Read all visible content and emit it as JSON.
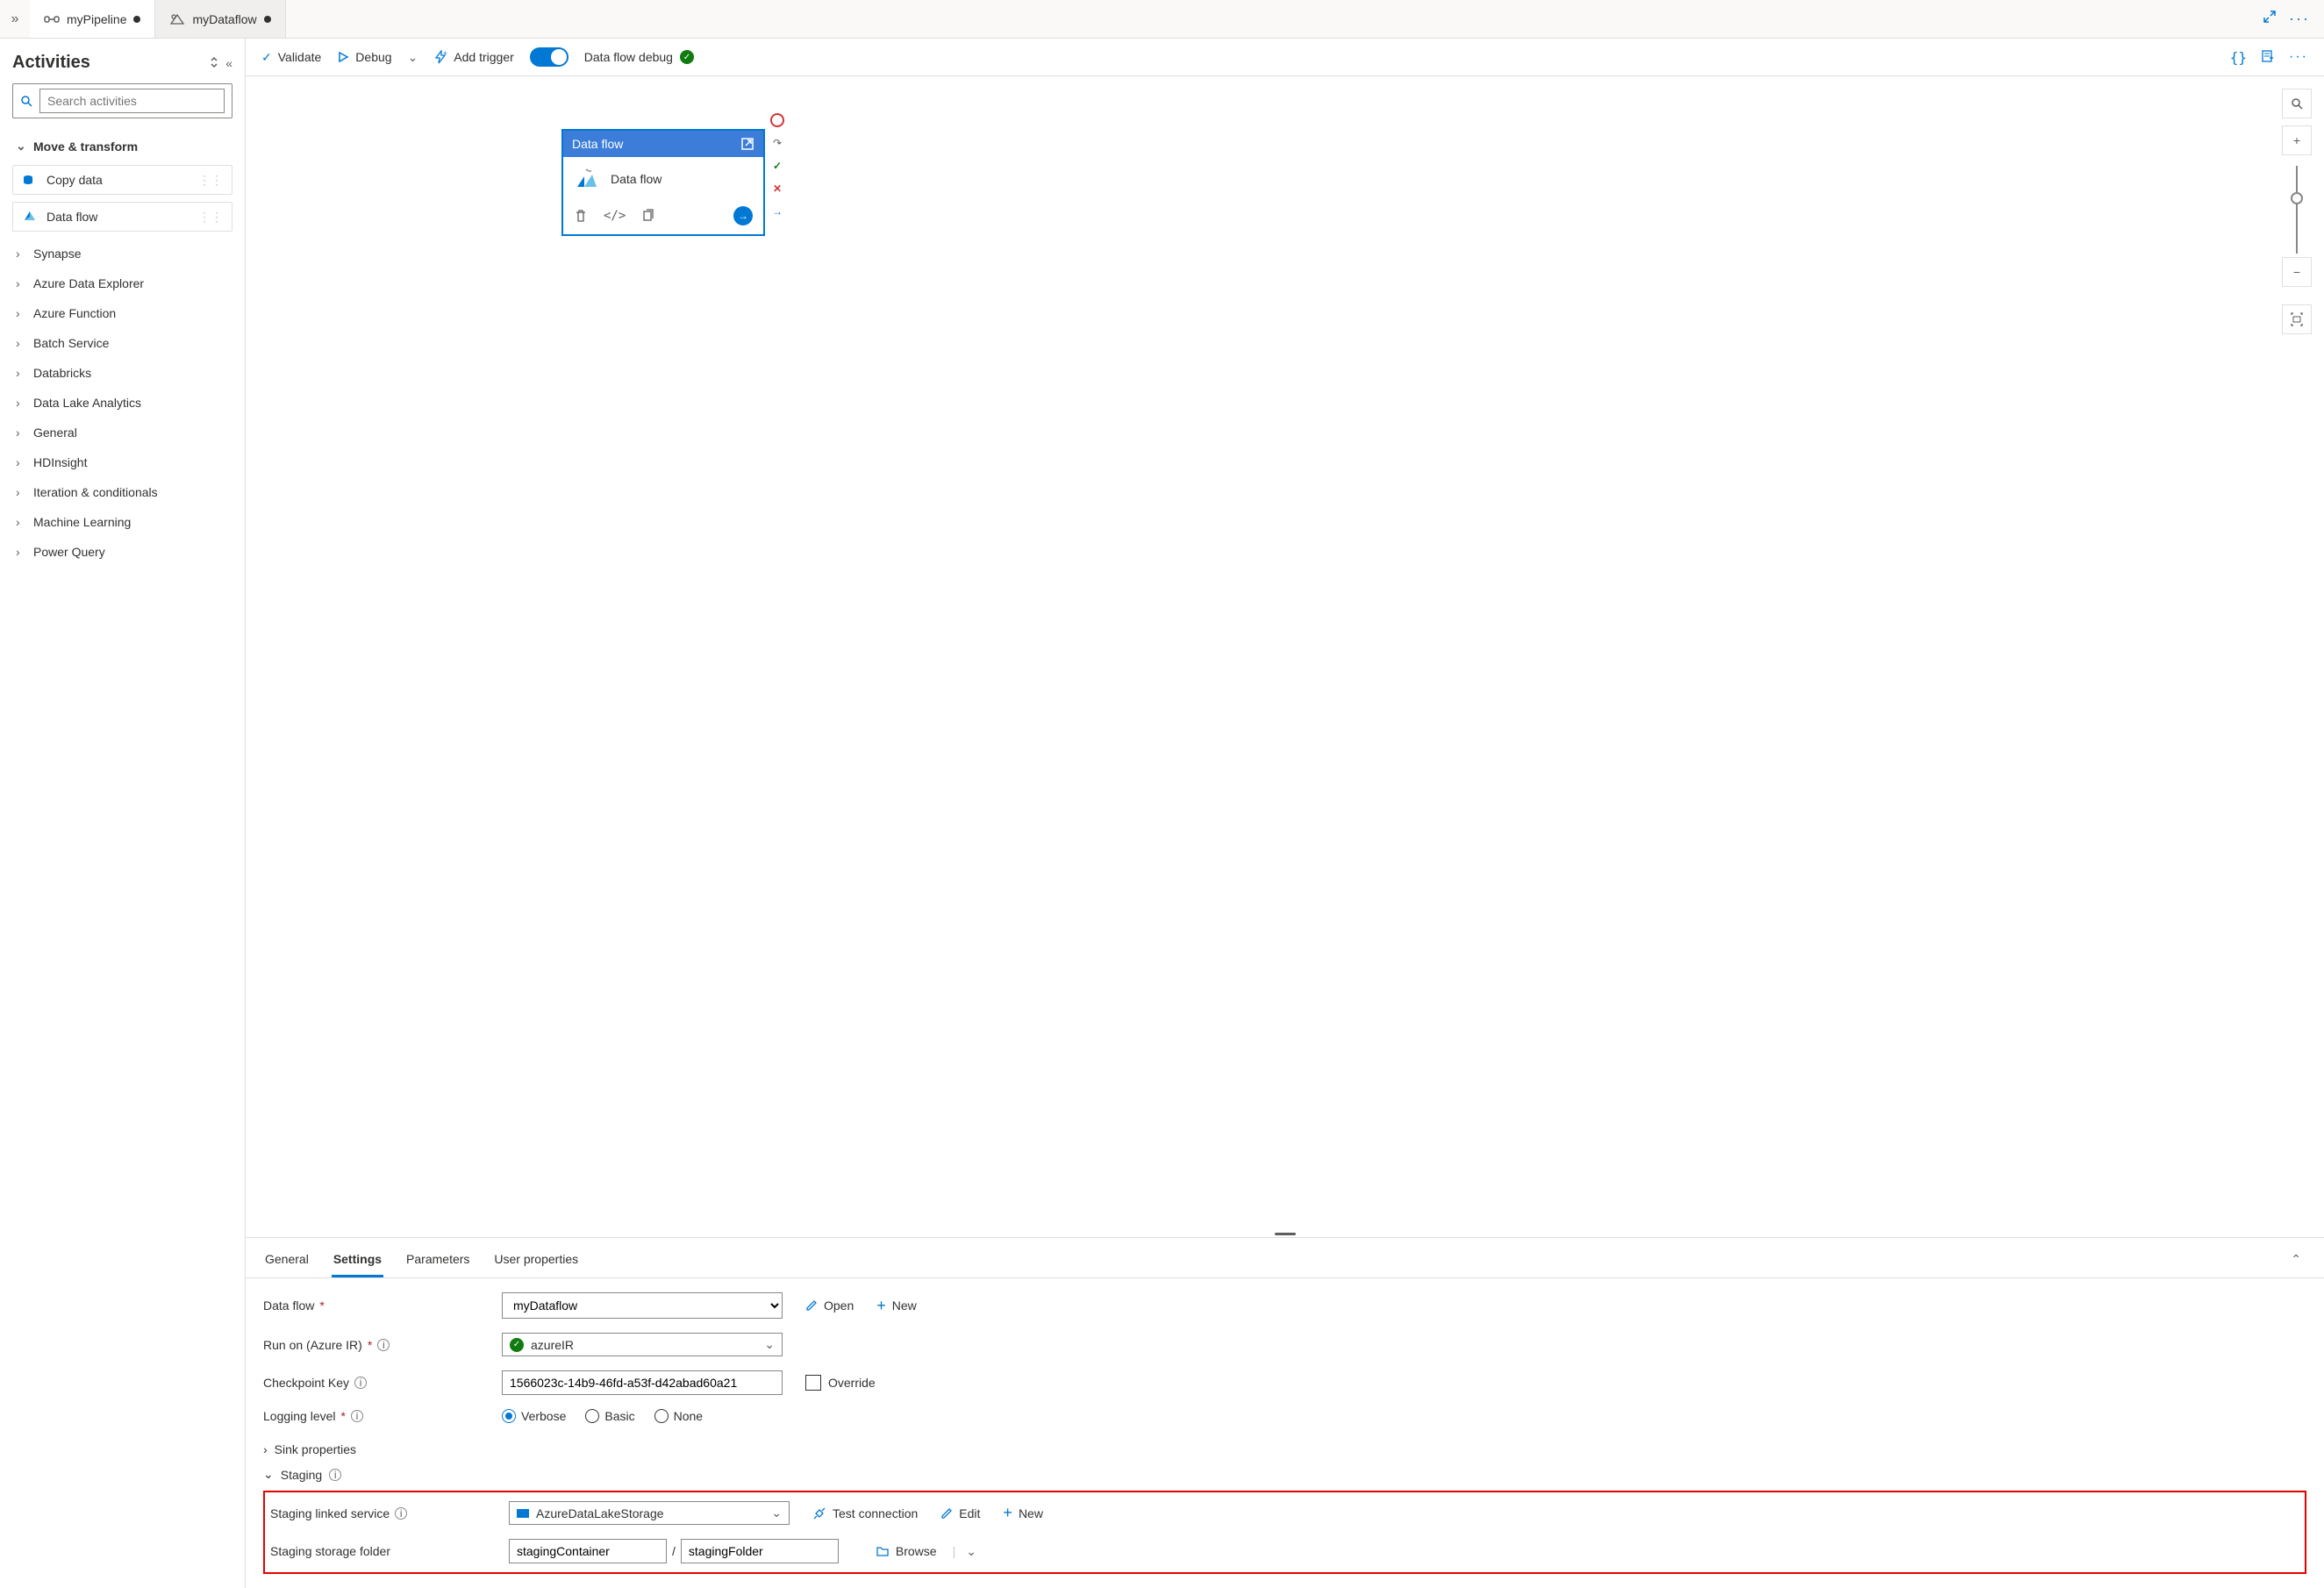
{
  "tabs": [
    {
      "label": "myPipeline",
      "dirty": true,
      "active": true,
      "icon": "pipeline"
    },
    {
      "label": "myDataflow",
      "dirty": true,
      "active": false,
      "icon": "dataflow"
    }
  ],
  "sidebar": {
    "title": "Activities",
    "search_placeholder": "Search activities",
    "categories": [
      {
        "label": "Move & transform",
        "expanded": true,
        "items": [
          {
            "label": "Copy data",
            "icon": "copy"
          },
          {
            "label": "Data flow",
            "icon": "dataflow"
          }
        ]
      },
      {
        "label": "Synapse",
        "expanded": false
      },
      {
        "label": "Azure Data Explorer",
        "expanded": false
      },
      {
        "label": "Azure Function",
        "expanded": false
      },
      {
        "label": "Batch Service",
        "expanded": false
      },
      {
        "label": "Databricks",
        "expanded": false
      },
      {
        "label": "Data Lake Analytics",
        "expanded": false
      },
      {
        "label": "General",
        "expanded": false
      },
      {
        "label": "HDInsight",
        "expanded": false
      },
      {
        "label": "Iteration & conditionals",
        "expanded": false
      },
      {
        "label": "Machine Learning",
        "expanded": false
      },
      {
        "label": "Power Query",
        "expanded": false
      }
    ]
  },
  "toolbar": {
    "validate": "Validate",
    "debug": "Debug",
    "add_trigger": "Add trigger",
    "dataflow_debug": "Data flow debug"
  },
  "node": {
    "header": "Data flow",
    "title": "Data flow"
  },
  "panel": {
    "tabs": [
      "General",
      "Settings",
      "Parameters",
      "User properties"
    ],
    "active_tab": "Settings"
  },
  "settings": {
    "dataflow_label": "Data flow",
    "dataflow_value": "myDataflow",
    "open": "Open",
    "new": "New",
    "runon_label": "Run on (Azure IR)",
    "runon_value": "azureIR",
    "checkpoint_label": "Checkpoint Key",
    "checkpoint_value": "1566023c-14b9-46fd-a53f-d42abad60a21",
    "override": "Override",
    "logging_label": "Logging level",
    "log_verbose": "Verbose",
    "log_basic": "Basic",
    "log_none": "None",
    "sink_props": "Sink properties",
    "staging": "Staging",
    "staging_linked_label": "Staging linked service",
    "staging_linked_value": "AzureDataLakeStorage",
    "test_connection": "Test connection",
    "edit": "Edit",
    "staging_folder_label": "Staging storage folder",
    "staging_container": "stagingContainer",
    "staging_folder": "stagingFolder",
    "browse": "Browse"
  }
}
